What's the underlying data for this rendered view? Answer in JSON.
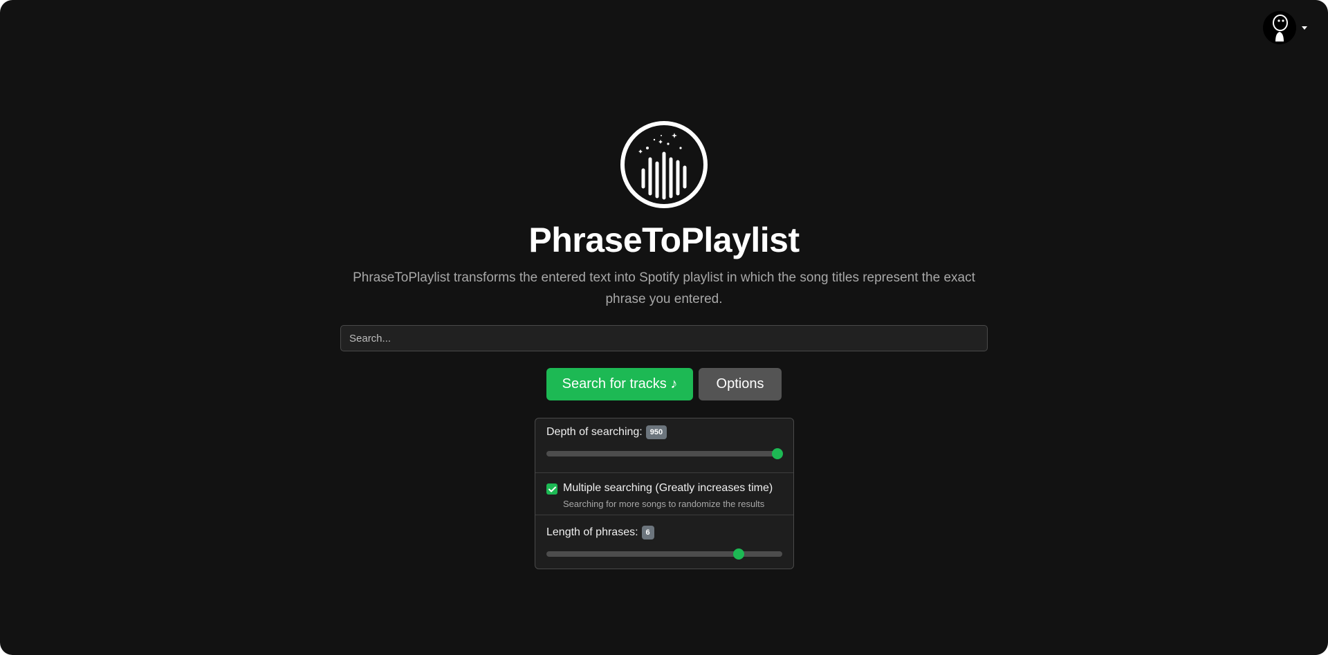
{
  "app": {
    "title": "PhraseToPlaylist",
    "description": "PhraseToPlaylist transforms the entered text into Spotify playlist in which the song titles represent the exact phrase you entered."
  },
  "search": {
    "placeholder": "Search...",
    "value": ""
  },
  "buttons": {
    "search_label": "Search for tracks ♪",
    "options_label": "Options"
  },
  "options": {
    "depth": {
      "label": "Depth of searching:",
      "value": "950"
    },
    "multiple": {
      "label": "Multiple searching (Greatly increases time)",
      "help": "Searching for more songs to randomize the results",
      "checked": true
    },
    "length": {
      "label": "Length of phrases:",
      "value": "6"
    }
  },
  "colors": {
    "accent": "#1db954",
    "background": "#121212",
    "secondary_button": "#545454"
  },
  "icons": {
    "logo": "sound-wave-circle-logo",
    "avatar": "user-avatar",
    "dropdown": "caret-down-icon",
    "check": "check-icon"
  }
}
